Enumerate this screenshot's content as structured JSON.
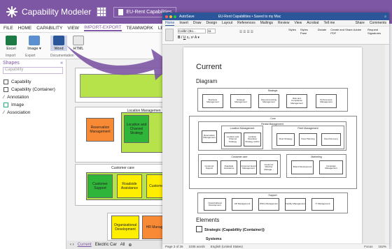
{
  "app": {
    "title": "Capability Modeler",
    "file_tab": "EU-Rent Capabilities",
    "menu": [
      "FILE",
      "HOME",
      "CAPABILITY",
      "VIEW",
      "IMPORT-EXPORT",
      "TEAMWORK",
      "LEAR"
    ],
    "active_menu": "IMPORT-EXPORT",
    "ribbon_buttons": [
      "Excel",
      "Image",
      "Word",
      "HTML"
    ],
    "ribbon_groups": [
      "Import",
      "Export",
      "Documentation"
    ]
  },
  "shapes": {
    "title": "Shapes",
    "filter": "Capability",
    "items": [
      "Capability",
      "Capability (Container)",
      "Annotation",
      "Image",
      "Association"
    ]
  },
  "canvas": {
    "location_title": "Location Managemen",
    "customer_title": "Customer care",
    "boxes": [
      "Reservation Management",
      "Location and Channel Strategy",
      "Customer Support",
      "Roadside Assistance",
      "Customer",
      "Organizational Development",
      "HR Manage"
    ]
  },
  "bottom_tabs": [
    "Current",
    "Electric Car",
    "All"
  ],
  "word": {
    "title": "EU-Rent Capabilities • Saved to my Mac",
    "autosave": "AutoSave",
    "tabs": [
      "Home",
      "Insert",
      "Draw",
      "Design",
      "Layout",
      "References",
      "Mailings",
      "Review",
      "View",
      "Acrobat",
      "Tell me"
    ],
    "share": "Share",
    "comments": "Comments",
    "font": "Calibri (Bo...",
    "font_size": "11",
    "ribbon_right": [
      "Styles",
      "Styles Pane",
      "Dictate",
      "Create and Share Adobe PDF",
      "Request Signatures"
    ],
    "doc_title": "Current",
    "diagram_heading": "Diagram",
    "elements_heading": "Elements",
    "strategic": "Strategic (Capability (Container))",
    "systems": "Systems",
    "status": [
      "Page 3 of 26",
      "1035 words",
      "English (United States)",
      "Focus",
      "162%"
    ],
    "diagram": {
      "strategic_label": "Strategic",
      "strategic_boxes": [
        "Business Management",
        "Strategic Management",
        "Fleet Accounting Management",
        "Risk and Compliance Management",
        "Performance Management"
      ],
      "core_label": "Core",
      "rental_label": "Rental Management",
      "location_label": "Location Management",
      "fleet_label": "Fleet Management",
      "rental_boxes": [
        "Reservation Management",
        "Location and Channel Strategy",
        "Location Operation Strategy and/or"
      ],
      "fleet_boxes": [
        "Fleet Strategy",
        "Fleet Planning",
        "Fleet Recovery"
      ],
      "customer_label": "Customer care",
      "customer_boxes": [
        "Customer Support",
        "Roadside Assistance",
        "Customer Event Management",
        "Customer Member Manage..."
      ],
      "marketing_label": "Marketing",
      "marketing_boxes": [
        "Brand Development",
        "Campaign Management"
      ],
      "support_label": "Support",
      "support_boxes": [
        "Organizational Development",
        "HR Management",
        "Office Management",
        "Facility Management",
        "IT Management"
      ]
    }
  },
  "colors": {
    "purple": "#7d57a3",
    "word_blue": "#2b579a",
    "green": "#2fb53a",
    "lime": "#b6e24a",
    "yellow": "#ffee00",
    "orange": "#f98a35"
  }
}
